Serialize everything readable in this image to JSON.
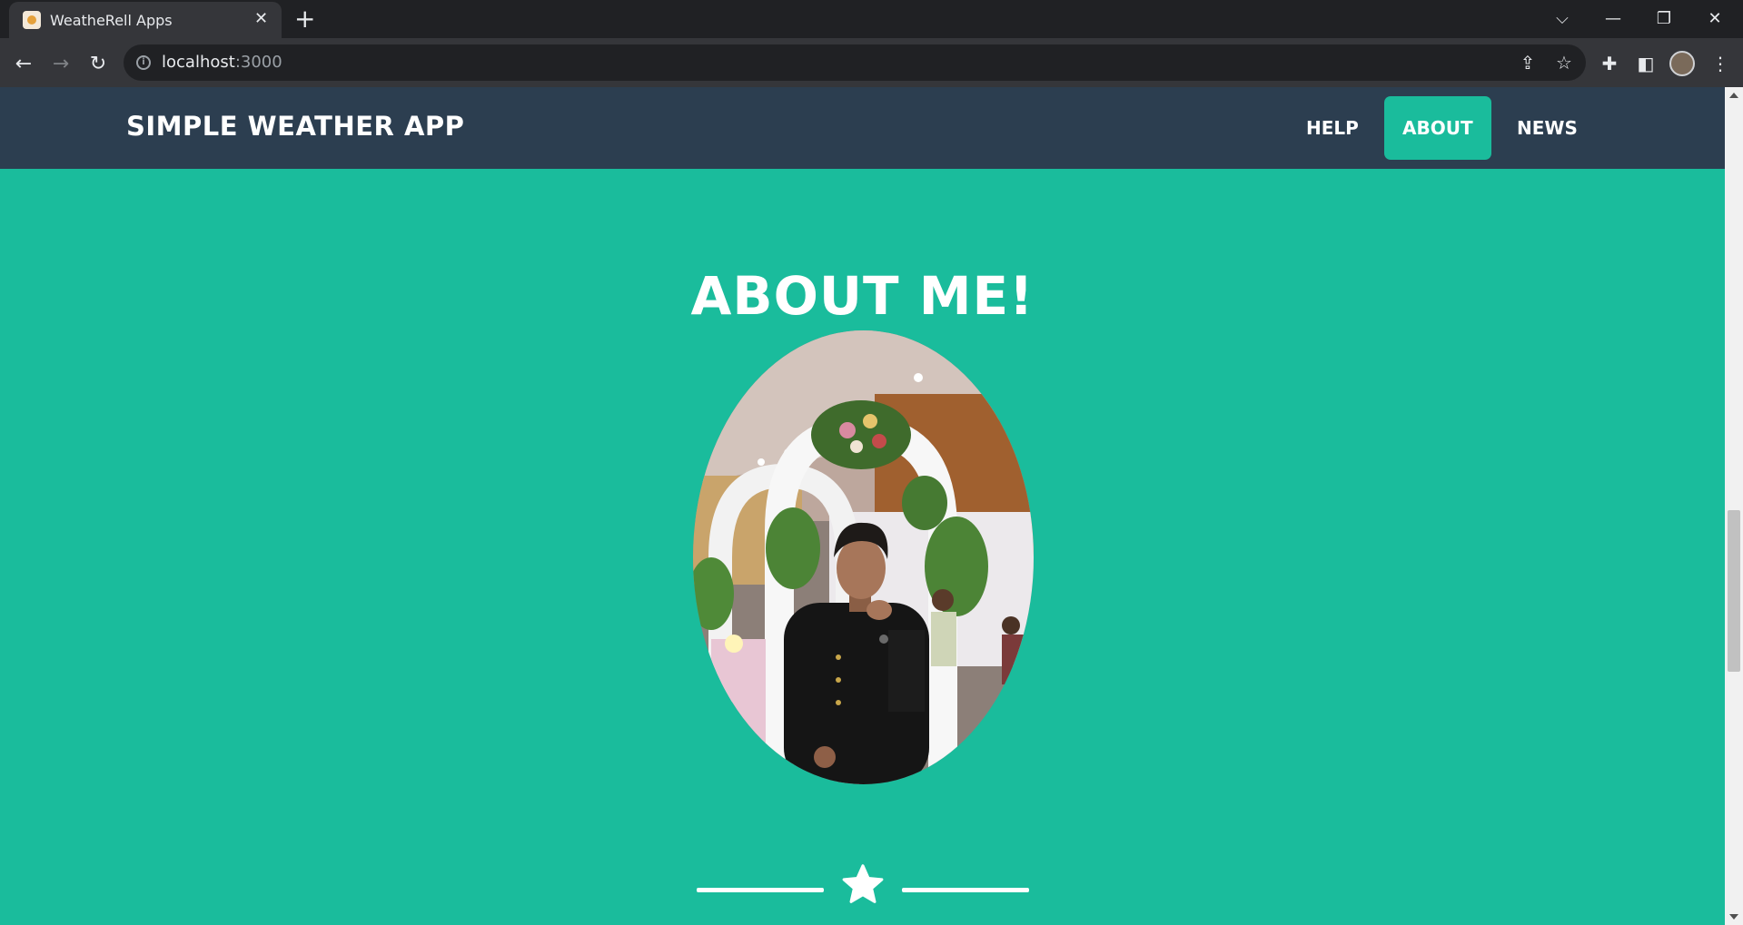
{
  "browser": {
    "tab_title": "WeatheRell Apps",
    "url_host": "localhost",
    "url_port": ":3000"
  },
  "navbar": {
    "brand": "SIMPLE WEATHER APP",
    "links": [
      {
        "label": "HELP",
        "active": false
      },
      {
        "label": "ABOUT",
        "active": true
      },
      {
        "label": "NEWS",
        "active": false
      }
    ]
  },
  "main": {
    "title": "ABOUT ME!"
  },
  "colors": {
    "page_background": "#1abc9c",
    "navbar_background": "#2c3e50",
    "active_link": "#1abc9c",
    "text": "#ffffff"
  },
  "icons": [
    "info-icon",
    "share-icon",
    "star-bookmark-icon",
    "extensions-icon",
    "side-panel-icon",
    "menu-icon",
    "star-divider-icon"
  ]
}
